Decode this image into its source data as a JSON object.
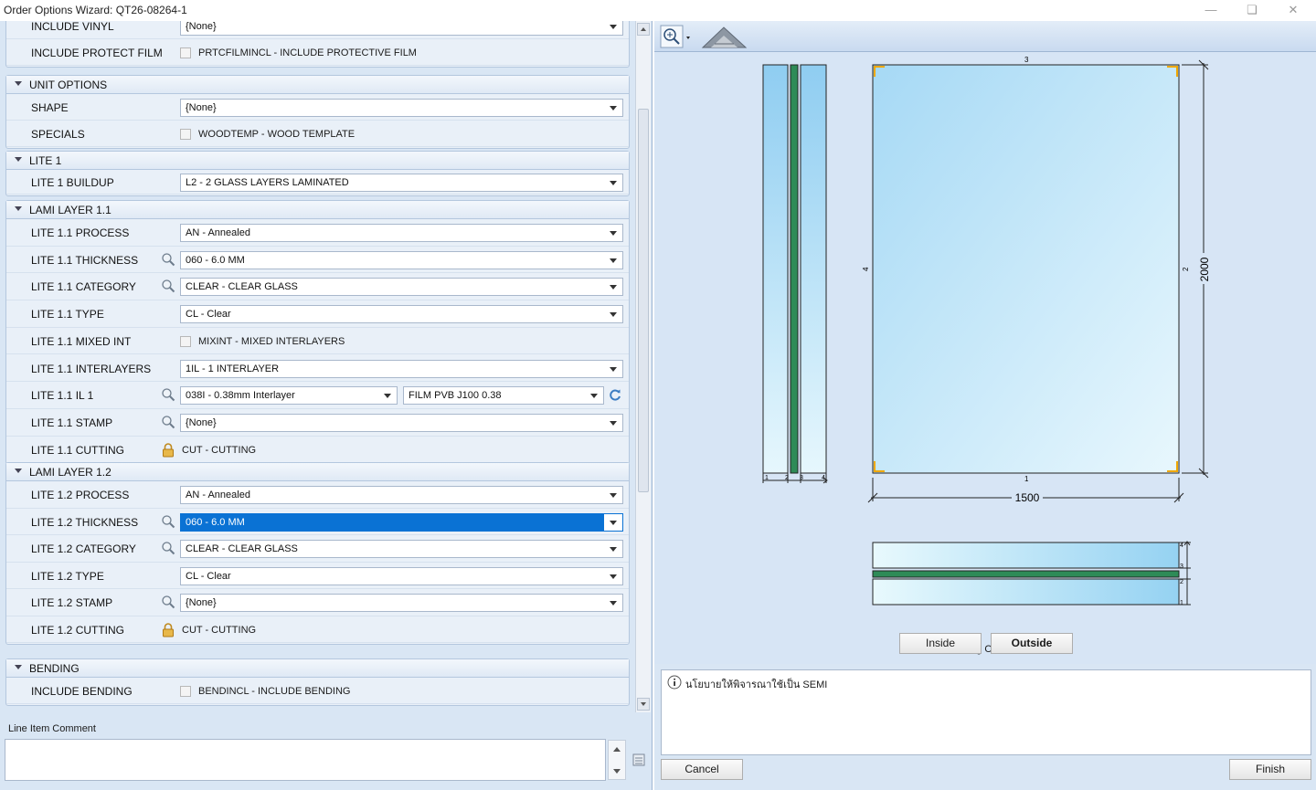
{
  "window": {
    "title": "Order Options Wizard: QT26-08264-1",
    "minimize_icon": "minimize-icon",
    "restore_icon": "restore-icon",
    "close_icon": "close-icon"
  },
  "groups": [
    {
      "title": "",
      "rows": [
        {
          "label": "INCLUDE VINYL",
          "type": "combo",
          "value": "{None}"
        },
        {
          "label": "INCLUDE PROTECT FILM",
          "type": "check",
          "value": "PRTCFILMINCL - INCLUDE PROTECTIVE FILM"
        }
      ]
    },
    {
      "title": "UNIT OPTIONS",
      "rows": [
        {
          "label": "SHAPE",
          "type": "combo",
          "value": "{None}"
        },
        {
          "label": "SPECIALS",
          "type": "check",
          "value": "WOODTEMP - WOOD TEMPLATE"
        }
      ]
    },
    {
      "title": "LITE 1",
      "rows": [
        {
          "label": "LITE 1 BUILDUP",
          "type": "combo",
          "value": "L2 - 2 GLASS LAYERS LAMINATED"
        }
      ]
    },
    {
      "title": "LAMI LAYER 1.1",
      "rows": [
        {
          "label": "LITE 1.1 PROCESS",
          "type": "combo",
          "value": "AN - Annealed"
        },
        {
          "label": "LITE 1.1 THICKNESS",
          "type": "combo",
          "search": true,
          "value": "060 - 6.0 MM"
        },
        {
          "label": "LITE 1.1 CATEGORY",
          "type": "combo",
          "search": true,
          "value": "CLEAR - CLEAR GLASS"
        },
        {
          "label": "LITE 1.1 TYPE",
          "type": "combo",
          "value": "CL - Clear"
        },
        {
          "label": "LITE 1.1 MIXED INT",
          "type": "check",
          "value": "MIXINT - MIXED INTERLAYERS"
        },
        {
          "label": "LITE 1.1 INTERLAYERS",
          "type": "combo",
          "value": "1IL - 1 INTERLAYER"
        },
        {
          "label": "LITE 1.1 IL 1",
          "type": "combo2",
          "search": true,
          "value": "038I - 0.38mm Interlayer",
          "value2": "FILM PVB J100 0.38"
        },
        {
          "label": "LITE 1.1 STAMP",
          "type": "combo",
          "search": true,
          "value": "{None}"
        },
        {
          "label": "LITE 1.1 CUTTING",
          "type": "lock",
          "value": "CUT - CUTTING"
        }
      ]
    },
    {
      "title": "LAMI LAYER 1.2",
      "rows": [
        {
          "label": "LITE 1.2 PROCESS",
          "type": "combo",
          "value": "AN - Annealed"
        },
        {
          "label": "LITE 1.2 THICKNESS",
          "type": "combo",
          "search": true,
          "selected": true,
          "value": "060 - 6.0 MM"
        },
        {
          "label": "LITE 1.2 CATEGORY",
          "type": "combo",
          "search": true,
          "value": "CLEAR - CLEAR GLASS"
        },
        {
          "label": "LITE 1.2 TYPE",
          "type": "combo",
          "value": "CL - Clear"
        },
        {
          "label": "LITE 1.2 STAMP",
          "type": "combo",
          "search": true,
          "value": "{None}"
        },
        {
          "label": "LITE 1.2 CUTTING",
          "type": "lock",
          "value": "CUT - CUTTING"
        }
      ]
    },
    {
      "title": "BENDING",
      "rows": [
        {
          "label": "INCLUDE BENDING",
          "type": "check",
          "value": "BENDINCL - INCLUDE BENDING"
        }
      ]
    }
  ],
  "comment": {
    "label": "Line Item Comment",
    "value": ""
  },
  "drawing": {
    "width_value": "1500",
    "height_value": "2000",
    "edge_top": "3",
    "edge_right": "2",
    "edge_bottom": "1",
    "edge_left": "4",
    "side_labels": [
      "1",
      "2",
      "3",
      "4"
    ],
    "section_labels": [
      "4",
      "3",
      "2",
      "1"
    ],
    "glass_color": "#a6d9f5",
    "interlayer_color": "#2e8b57",
    "corner_color": "#f0a800"
  },
  "view": {
    "label": "Viewing Outside",
    "inside": "Inside",
    "outside": "Outside"
  },
  "notes": {
    "text": "นโยบายให้พิจารณาใช้เป็น SEMI"
  },
  "buttons": {
    "cancel": "Cancel",
    "finish": "Finish"
  }
}
